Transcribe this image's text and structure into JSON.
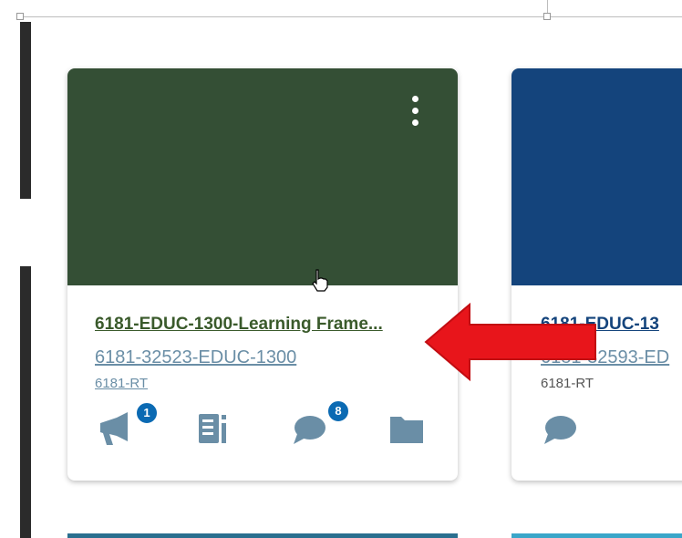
{
  "courses": [
    {
      "title": "6181-EDUC-1300-Learning Frame...",
      "code": "6181-32523-EDUC-1300",
      "term": "6181-RT",
      "hero_color": "#344f35",
      "actions": [
        {
          "icon": "megaphone-icon",
          "label": "Announcements",
          "badge": "1"
        },
        {
          "icon": "assignments-icon",
          "label": "Assignments",
          "badge": ""
        },
        {
          "icon": "discussion-icon",
          "label": "Discussions",
          "badge": "8"
        },
        {
          "icon": "folder-icon",
          "label": "Files",
          "badge": ""
        }
      ]
    },
    {
      "title": "6181-EDUC-13",
      "code": "6181-32593-ED",
      "term": "6181-RT",
      "hero_color": "#14447c",
      "actions": [
        {
          "icon": "discussion-icon",
          "label": "Discussions",
          "badge": ""
        }
      ]
    }
  ],
  "colors": {
    "icon": "#6a8ea6",
    "badge": "#0b6ab3",
    "arrow": "#e8151b"
  }
}
